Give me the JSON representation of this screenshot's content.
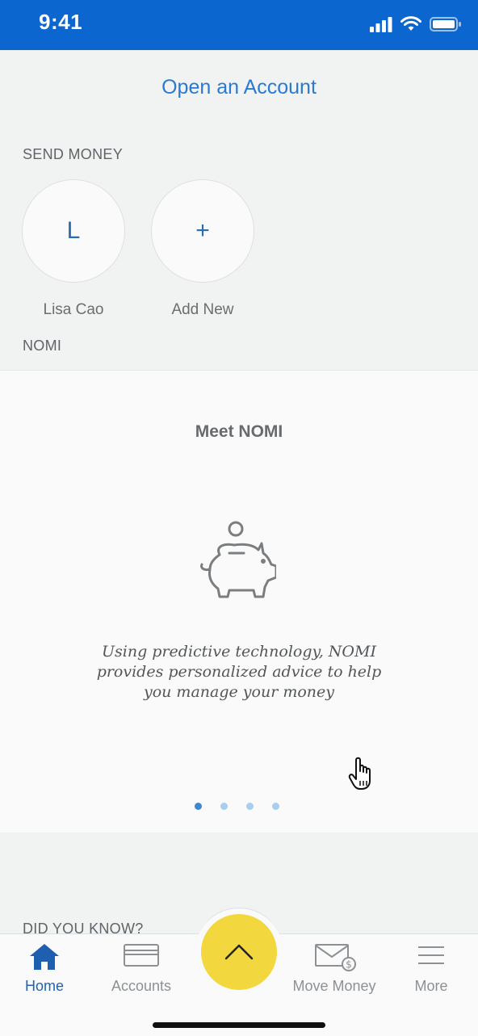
{
  "status_bar": {
    "time": "9:41"
  },
  "main": {
    "open_account_link": "Open an Account",
    "send_money": {
      "label": "SEND MONEY",
      "contacts": [
        {
          "initial": "L",
          "name": "Lisa Cao"
        },
        {
          "initial": "+",
          "name": "Add New"
        }
      ]
    },
    "nomi_label": "NOMI",
    "nomi_card": {
      "title": "Meet NOMI",
      "icon": "piggy-bank-icon",
      "description_lines": [
        "Using predictive technology, NOMI",
        "provides personalized advice to help",
        "you manage your money"
      ],
      "carousel": {
        "pages": 4,
        "active_page": 1
      }
    },
    "did_you_know_label": "DID YOU KNOW?"
  },
  "tab_bar": {
    "tabs": [
      {
        "label": "Home",
        "icon": "home-icon",
        "active": true
      },
      {
        "label": "Accounts",
        "icon": "card-icon",
        "active": false
      },
      {
        "label": "Move Money",
        "icon": "envelope-money-icon",
        "active": false
      },
      {
        "label": "More",
        "icon": "menu-icon",
        "active": false
      }
    ],
    "fab_icon": "chevron-up-icon"
  },
  "colors": {
    "status_bar": "#0b66cf",
    "link_blue": "#2a7ad0",
    "active_tab": "#1f63b4",
    "fab_yellow": "#f2d83e",
    "background": "#f1f2f2"
  }
}
